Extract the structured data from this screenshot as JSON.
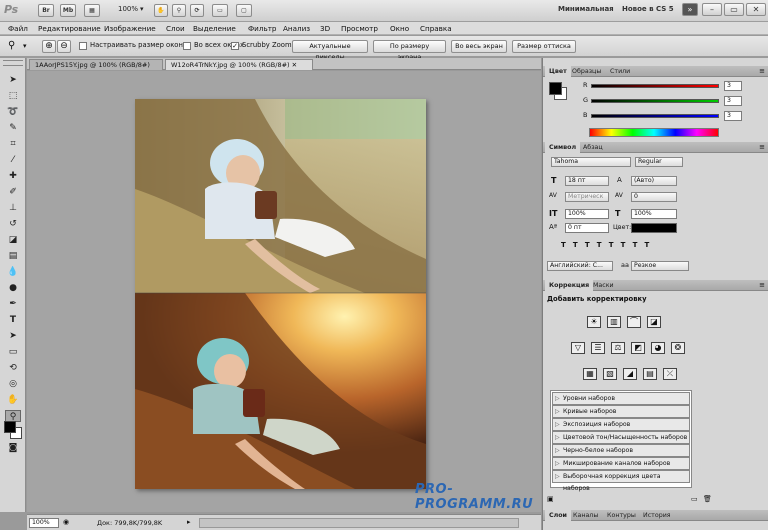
{
  "titlebar": {
    "logo": "Ps",
    "br": "Br",
    "mb": "Mb",
    "zoom": "100%",
    "workspace": "Минимальная",
    "new_in": "Новое в CS 5",
    "expand": "»"
  },
  "menu": [
    "Файл",
    "Редактирование",
    "Изображение",
    "Слои",
    "Выделение",
    "Фильтр",
    "Анализ",
    "3D",
    "Просмотр",
    "Окно",
    "Справка"
  ],
  "options": {
    "resize_windows": "Настраивать размер окон",
    "all_windows": "Во всех окнах",
    "scrubby_zoom": "Scrubby Zoom",
    "actual_pixels": "Актуальные пикселы",
    "fit_screen": "По размеру экрана",
    "fill_screen": "Во весь экран",
    "print_size": "Размер оттиска"
  },
  "tabs": [
    {
      "label": "1AAorJPS15Y.jpg @ 100% (RGB/8#)",
      "active": false
    },
    {
      "label": "W12oR4TrNkY.jpg @ 100% (RGB/8#)",
      "active": true
    }
  ],
  "status": {
    "zoom": "100%",
    "doc": "Док: 799,8K/799,8K"
  },
  "color_panel": {
    "tabs": [
      "Цвет",
      "Образцы",
      "Стили"
    ],
    "r_label": "R",
    "g_label": "G",
    "b_label": "B",
    "r": "3",
    "g": "3",
    "b": "3",
    "fg": "#000000",
    "bg": "#ffffff"
  },
  "char_panel": {
    "tabs": [
      "Символ",
      "Абзац"
    ],
    "font": "Tahoma",
    "style": "Regular",
    "size": "18 пт",
    "leading": "(Авто)",
    "kerning": "Метрическ",
    "tracking": "0",
    "vscale": "100%",
    "hscale": "100%",
    "baseline": "0 пт",
    "color_label": "Цвет:",
    "lang": "Английский: С...",
    "aa_icon": "aa",
    "aa": "Резкое"
  },
  "adj_panel": {
    "tabs": [
      "Коррекция",
      "Маски"
    ],
    "title": "Добавить корректировку",
    "presets": [
      "Уровни наборов",
      "Кривые наборов",
      "Экспозиция наборов",
      "Цветовой тон/Насыщенность наборов",
      "Черно-белое наборов",
      "Микширование каналов наборов",
      "Выборочная коррекция цвета наборов"
    ]
  },
  "layers_panel": {
    "tabs": [
      "Слои",
      "Каналы",
      "Контуры",
      "История"
    ]
  },
  "watermark": "PRO-PROGRAMM.RU"
}
